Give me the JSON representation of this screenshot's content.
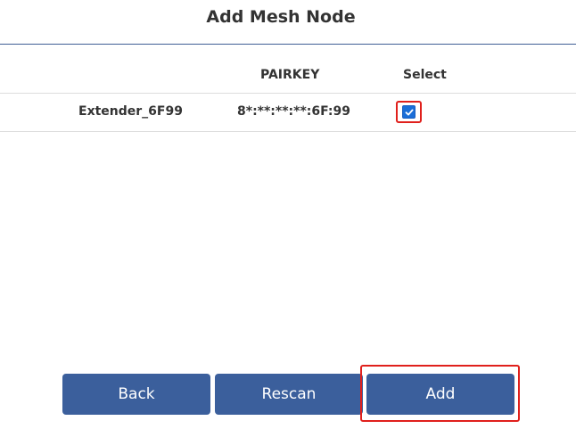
{
  "page": {
    "title": "Add Mesh Node"
  },
  "table": {
    "columns": [
      "PAIRKEY",
      "Select"
    ],
    "rows": [
      {
        "name": "Extender_6F99",
        "pairkey": "8*:**:**:**:6F:99",
        "selected": true
      }
    ]
  },
  "buttons": {
    "back_label": "Back",
    "rescan_label": "Rescan",
    "add_label": "Add"
  },
  "colors": {
    "accent": "#3b5f9c",
    "highlight": "#e0201c",
    "checkbox": "#1a6ed8"
  },
  "icons": {
    "checkbox_checked": "check-icon"
  }
}
